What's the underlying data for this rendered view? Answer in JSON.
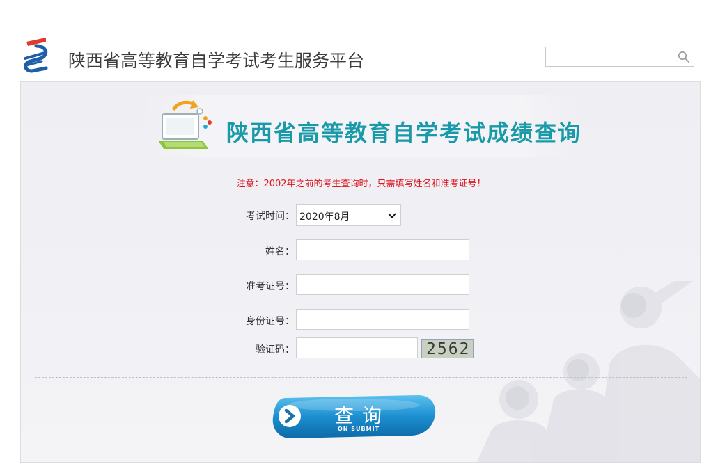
{
  "header": {
    "site_title": "陕西省高等教育自学考试考生服务平台",
    "search_placeholder": ""
  },
  "banner": {
    "title": "陕西省高等教育自学考试成绩查询"
  },
  "notice": "注意：2002年之前的考生查询时，只需填写姓名和准考证号！",
  "form": {
    "exam_time_label": "考试时间：",
    "exam_time_value": "2020年8月",
    "name_label": "姓名：",
    "name_value": "",
    "ticket_label": "准考证号：",
    "ticket_value": "",
    "id_label": "身份证号：",
    "id_value": "",
    "captcha_label": "验证码：",
    "captcha_value": "",
    "captcha_image_text": "2562"
  },
  "submit": {
    "label_cn": "查询",
    "label_en": "ON SUBMIT"
  },
  "colors": {
    "notice": "#e0141e",
    "banner_title": "#1a9aa8",
    "submit_blue": "#1c8ed0"
  }
}
